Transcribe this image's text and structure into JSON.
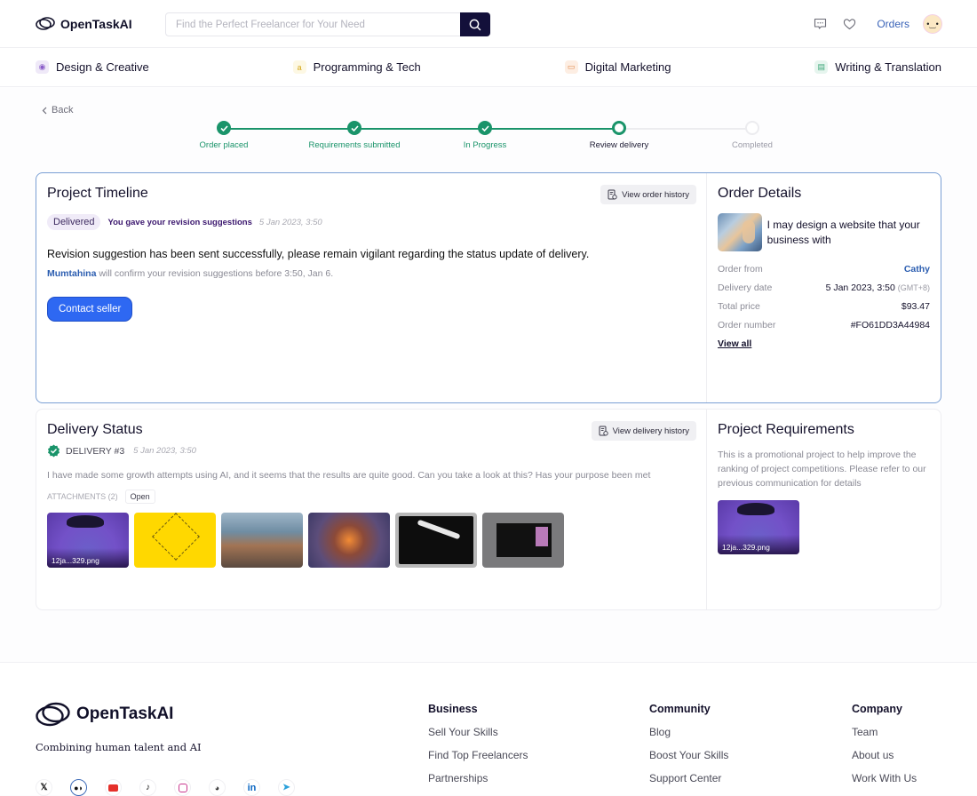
{
  "header": {
    "brand": "OpenTaskAI",
    "search_placeholder": "Find the Perfect Freelancer for Your Need",
    "orders_label": "Orders",
    "icons": [
      "message-icon",
      "heart-icon",
      "avatar"
    ]
  },
  "categories": [
    {
      "label": "Design & Creative",
      "icon": "palette-icon"
    },
    {
      "label": "Programming & Tech",
      "icon": "code-icon"
    },
    {
      "label": "Digital Marketing",
      "icon": "briefcase-icon"
    },
    {
      "label": "Writing & Translation",
      "icon": "document-icon"
    }
  ],
  "back_label": "Back",
  "stepper": {
    "steps": [
      {
        "label": "Order placed",
        "state": "done"
      },
      {
        "label": "Requirements submitted",
        "state": "done"
      },
      {
        "label": "In Progress",
        "state": "done"
      },
      {
        "label": "Review delivery",
        "state": "current"
      },
      {
        "label": "Completed",
        "state": "pending"
      }
    ]
  },
  "timeline": {
    "title": "Project Timeline",
    "history_button": "View order history",
    "badge": "Delivered",
    "status_text": "You gave your revision suggestions",
    "status_time": "5 Jan 2023, 3:50",
    "message": "Revision suggestion has been sent successfully, please remain vigilant regarding the status update of delivery.",
    "seller_name": "Mumtahina",
    "sub_message": " will confirm your revision suggestions before 3:50, Jan 6.",
    "contact_button": "Contact seller"
  },
  "order_details": {
    "title": "Order Details",
    "product_title": "I may design a website that your business with",
    "rows": [
      {
        "key": "Order from",
        "value": "Cathy"
      },
      {
        "key": "Delivery date",
        "value": "5 Jan 2023, 3:50",
        "suffix": "(GMT+8)"
      },
      {
        "key": "Total price",
        "value": "$93.47"
      },
      {
        "key": "Order number",
        "value": "#FO61DD3A44984"
      }
    ],
    "view_all": "View all"
  },
  "delivery": {
    "title": "Delivery Status",
    "history_button": "View delivery history",
    "label": "DELIVERY #3",
    "time": "5 Jan 2023, 3:50",
    "message": "I have made some growth attempts using AI, and it seems that the results are quite good. Can you take a look at this? Has your purpose been met",
    "attachments_label": "ATTACHMENTS (2)",
    "open_button": "Open",
    "attachments": [
      {
        "name": "12ja...329.png"
      },
      {
        "name": ""
      },
      {
        "name": ""
      },
      {
        "name": ""
      },
      {
        "name": ""
      },
      {
        "name": ""
      }
    ]
  },
  "requirements": {
    "title": "Project Requirements",
    "text": "This is a promotional project to help improve the ranking of project competitions. Please refer to our previous communication for details",
    "attachment_name": "12ja...329.png"
  },
  "footer": {
    "brand": "OpenTaskAI",
    "tagline": "Combining human talent and AI",
    "socials": [
      "x-icon",
      "medium-icon",
      "youtube-icon",
      "tiktok-icon",
      "instagram-icon",
      "discord-icon",
      "linkedin-icon",
      "telegram-icon"
    ],
    "columns": [
      {
        "title": "Business",
        "links": [
          "Sell Your Skills",
          "Find Top Freelancers",
          "Partnerships"
        ]
      },
      {
        "title": "Community",
        "links": [
          "Blog",
          "Boost Your Skills",
          "Support Center"
        ]
      },
      {
        "title": "Company",
        "links": [
          "Team",
          "About us",
          "Work With Us"
        ]
      }
    ]
  },
  "colors": {
    "accent_green": "#1a946a",
    "primary_blue": "#2e68f2",
    "link_blue": "#2b5db0",
    "navy": "#13103a"
  }
}
